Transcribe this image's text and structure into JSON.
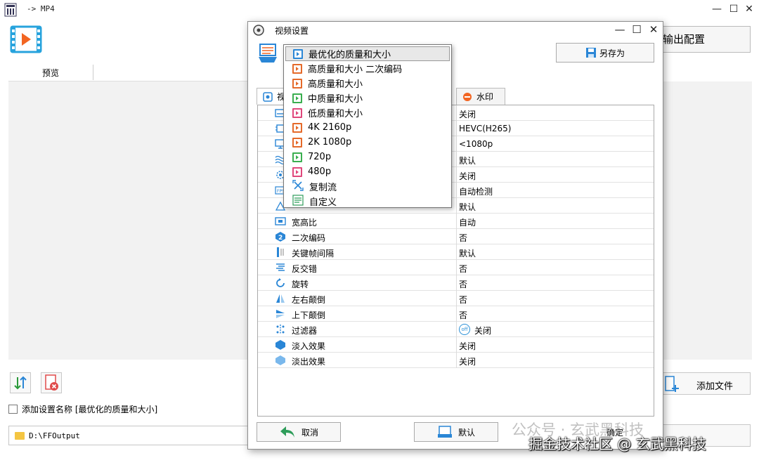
{
  "main": {
    "title": "-> MP4",
    "preview_label": "预览",
    "output_config_label": "输出配置",
    "save_name_label": "添加设置名称 [最优化的质量和大小]",
    "output_path": "D:\\FFOutput",
    "add_file_label": "添加文件"
  },
  "dialog": {
    "title": "视频设置",
    "save_as_label": "另存为",
    "tabs": {
      "video": "视",
      "watermark": "水印"
    },
    "settings": [
      {
        "name": "",
        "value": "关闭",
        "icon": "subtitle-icon"
      },
      {
        "name": "",
        "value": "HEVC(H265)",
        "icon": "codec-chip-icon"
      },
      {
        "name": "",
        "value": "<1080p",
        "icon": "monitor-icon"
      },
      {
        "name": "",
        "value": "默认",
        "icon": "waves-icon"
      },
      {
        "name": "",
        "value": "关闭",
        "icon": "gear-icon"
      },
      {
        "name": "",
        "value": "自动检测",
        "icon": "fps-icon"
      },
      {
        "name": "",
        "value": "默认",
        "icon": "bitrate-icon"
      },
      {
        "name": "宽高比",
        "value": "自动",
        "icon": "aspect-ratio-icon"
      },
      {
        "name": "二次编码",
        "value": "否",
        "icon": "two-pass-icon"
      },
      {
        "name": "关键帧间隔",
        "value": "默认",
        "icon": "keyframe-icon"
      },
      {
        "name": "反交错",
        "value": "否",
        "icon": "deinterlace-icon"
      },
      {
        "name": "旋转",
        "value": "否",
        "icon": "rotate-icon"
      },
      {
        "name": "左右颠倒",
        "value": "否",
        "icon": "flip-horizontal-icon"
      },
      {
        "name": "上下颠倒",
        "value": "否",
        "icon": "flip-vertical-icon"
      },
      {
        "name": "过滤器",
        "value": "关闭",
        "icon": "filter-icon",
        "badge": "off"
      },
      {
        "name": "淡入效果",
        "value": "关闭",
        "icon": "fade-in-icon"
      },
      {
        "name": "淡出效果",
        "value": "关闭",
        "icon": "fade-out-icon"
      }
    ],
    "cancel_label": "取消",
    "default_label": "默认",
    "confirm_label": "确定"
  },
  "dropdown": {
    "options": [
      {
        "label": "最优化的质量和大小",
        "icon": "blue",
        "selected": true
      },
      {
        "label": "高质量和大小 二次编码",
        "icon": "orange"
      },
      {
        "label": "高质量和大小",
        "icon": "orange"
      },
      {
        "label": "中质量和大小",
        "icon": "green"
      },
      {
        "label": "低质量和大小",
        "icon": "pink"
      },
      {
        "label": "4K 2160p",
        "icon": "orange"
      },
      {
        "label": "2K 1080p",
        "icon": "orange"
      },
      {
        "label": "720p",
        "icon": "green"
      },
      {
        "label": "480p",
        "icon": "pink"
      },
      {
        "label": "复制流",
        "icon": "copy-stream"
      },
      {
        "label": "自定义",
        "icon": "custom"
      }
    ]
  },
  "watermark": {
    "line1": "公众号 · 玄武黑科技",
    "line2": "掘金技术社区 @ 玄武黑科技"
  }
}
